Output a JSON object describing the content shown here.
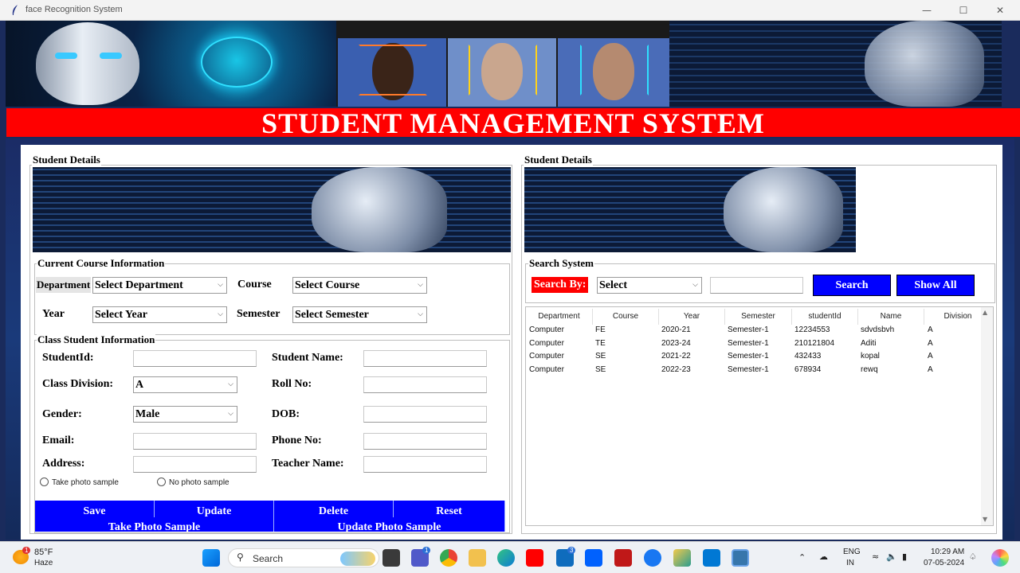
{
  "window": {
    "title": "face Recognition System",
    "minimize": "—",
    "maximize": "☐",
    "close": "✕"
  },
  "header": {
    "title": "STUDENT MANAGEMENT SYSTEM"
  },
  "left": {
    "frame_title": "Student Details",
    "course": {
      "title": "Current Course Information",
      "department_label": "Department",
      "department_value": "Select Department",
      "course_label": "Course",
      "course_value": "Select Course",
      "year_label": "Year",
      "year_value": "Select Year",
      "semester_label": "Semester",
      "semester_value": "Select Semester"
    },
    "class": {
      "title": "Class Student Information",
      "student_id_label": "StudentId:",
      "student_name_label": "Student Name:",
      "division_label": "Class Division:",
      "division_value": "A",
      "roll_label": "Roll No:",
      "gender_label": "Gender:",
      "gender_value": "Male",
      "dob_label": "DOB:",
      "email_label": "Email:",
      "phone_label": "Phone No:",
      "address_label": "Address:",
      "teacher_label": "Teacher Name:",
      "radio_take": "Take photo sample",
      "radio_no": "No photo sample"
    },
    "buttons": {
      "save": "Save",
      "update": "Update",
      "delete": "Delete",
      "reset": "Reset",
      "take_photo": "Take Photo Sample",
      "update_photo": "Update Photo Sample"
    }
  },
  "right": {
    "frame_title": "Student Details",
    "search": {
      "title": "Search System",
      "search_by_label": "Search By:",
      "search_by_value": "Select",
      "search_button": "Search",
      "show_all_button": "Show All"
    },
    "table": {
      "headers": [
        "Department",
        "Course",
        "Year",
        "Semester",
        "studentId",
        "Name",
        "Division"
      ],
      "rows": [
        [
          "Computer",
          "FE",
          "2020-21",
          "Semester-1",
          "12234553",
          "sdvdsbvh",
          "A"
        ],
        [
          "Computer",
          "TE",
          "2023-24",
          "Semester-1",
          "210121804",
          "Aditi",
          "A"
        ],
        [
          "Computer",
          "SE",
          "2021-22",
          "Semester-1",
          "432433",
          "kopal",
          "A"
        ],
        [
          "Computer",
          "SE",
          "2022-23",
          "Semester-1",
          "678934",
          "rewq",
          "A"
        ]
      ]
    }
  },
  "taskbar": {
    "weather_temp": "85°F",
    "weather_desc": "Haze",
    "weather_badge": "1",
    "search": "Search",
    "teams_badge": "1",
    "mail_badge": "3",
    "lang_top": "ENG",
    "lang_bottom": "IN",
    "time": "10:29 AM",
    "date": "07-05-2024"
  }
}
